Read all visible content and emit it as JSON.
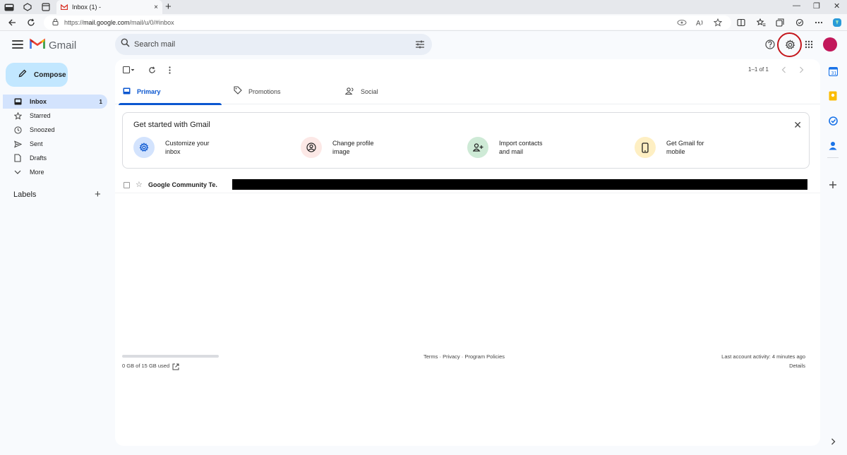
{
  "browser": {
    "tab_title": "Inbox (1) -",
    "tab_close": "×",
    "new_tab": "+",
    "url_prefix": "https://",
    "url_host": "mail.google.com",
    "url_path": "/mail/u/0/#inbox",
    "window_controls": [
      "—",
      "❐",
      "✕"
    ]
  },
  "header": {
    "app_name": "Gmail",
    "search_placeholder": "Search mail",
    "icons": [
      "help-icon",
      "settings-icon",
      "apps-grid-icon",
      "account-avatar"
    ],
    "accent_color": "#c4161c"
  },
  "compose": {
    "label": "Compose"
  },
  "nav": [
    {
      "label": "Inbox",
      "count": "1",
      "active": true,
      "icon": "inbox-icon"
    },
    {
      "label": "Starred",
      "count": "",
      "icon": "star-icon"
    },
    {
      "label": "Snoozed",
      "count": "",
      "icon": "clock-icon"
    },
    {
      "label": "Sent",
      "count": "",
      "icon": "send-icon"
    },
    {
      "label": "Drafts",
      "count": "",
      "icon": "draft-icon"
    },
    {
      "label": "More",
      "count": "",
      "icon": "chevron-down-icon"
    }
  ],
  "labels": {
    "title": "Labels",
    "add": "+"
  },
  "toolbar": {
    "pager": "1–1 of 1"
  },
  "tabs": [
    {
      "label": "Primary",
      "active": true
    },
    {
      "label": "Promotions"
    },
    {
      "label": "Social"
    }
  ],
  "get_started": {
    "title": "Get started with Gmail",
    "close": "✕",
    "items": [
      {
        "line1": "Customize your",
        "line2": "inbox",
        "icon": "gear-icon"
      },
      {
        "line1": "Change profile",
        "line2": "image",
        "icon": "profile-icon"
      },
      {
        "line1": "Import contacts",
        "line2": "and mail",
        "icon": "person-add-icon"
      },
      {
        "line1": "Get Gmail for",
        "line2": "mobile",
        "icon": "phone-icon"
      }
    ]
  },
  "emails": [
    {
      "sender": "Google Community Te.",
      "star": "☆"
    }
  ],
  "footer": {
    "storage": "0 GB of 15 GB used",
    "links": "Terms · Privacy · Program Policies",
    "last_activity": "Last account activity: 4 minutes ago",
    "details": "Details"
  }
}
